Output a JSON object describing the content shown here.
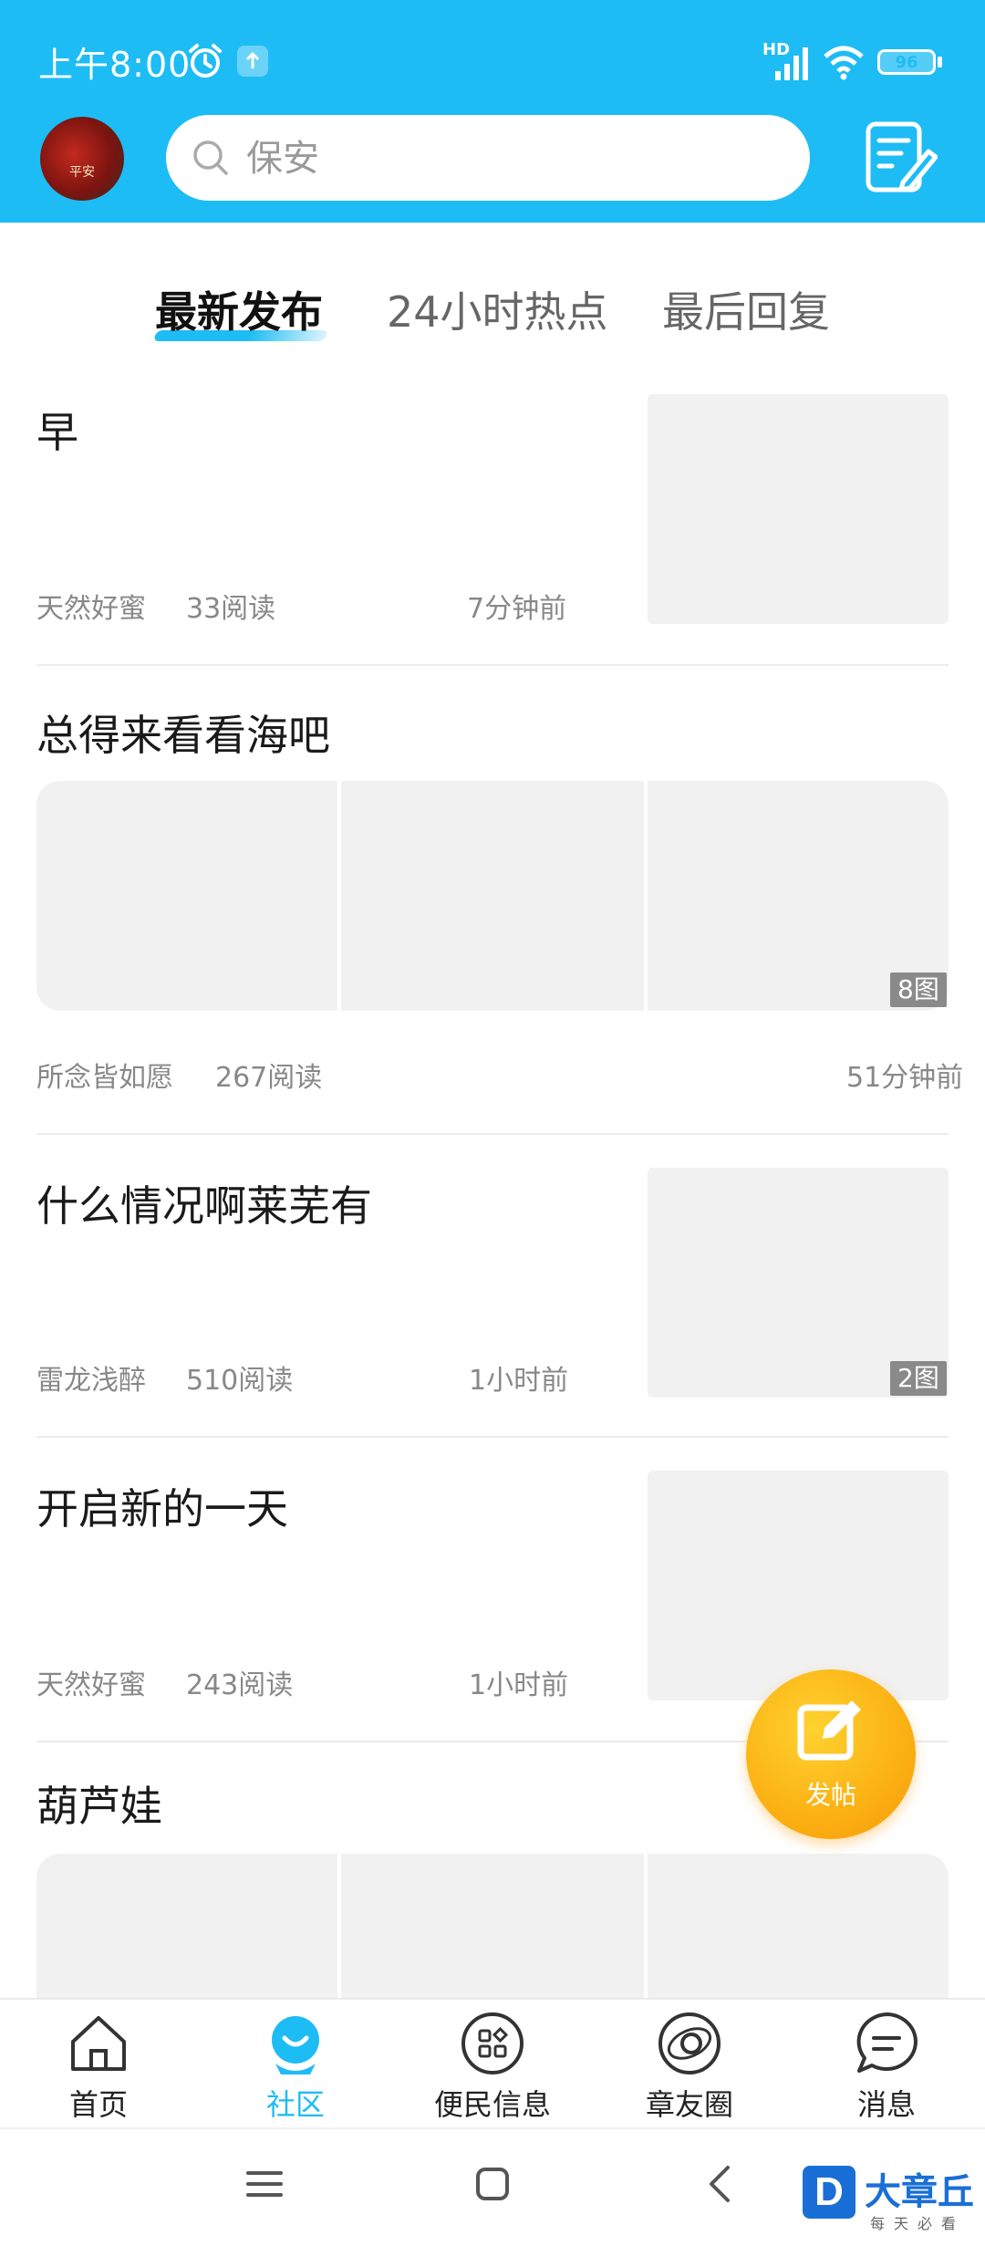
{
  "status_bar": {
    "time": "上午8:00",
    "hd": "HD",
    "battery": "96",
    "battery_level": 0.96
  },
  "header": {
    "avatar_text": "平安",
    "search_placeholder": "保安",
    "colors": {
      "brand": "#1ebcf4",
      "accent": "#fbb013"
    }
  },
  "tabs": [
    {
      "label": "最新发布",
      "active": true
    },
    {
      "label": "24小时热点",
      "active": false
    },
    {
      "label": "最后回复",
      "active": false
    }
  ],
  "posts": [
    {
      "title": "早",
      "author": "天然好蜜",
      "reads": "33阅读",
      "time": "7分钟前"
    },
    {
      "title": "总得来看看海吧",
      "author": "所念皆如愿",
      "reads": "267阅读",
      "time": "51分钟前",
      "image_count": "8图"
    },
    {
      "title": "什么情况啊莱芜有",
      "author": "雷龙浅醉",
      "reads": "510阅读",
      "time": "1小时前",
      "image_count": "2图"
    },
    {
      "title": "开启新的一天",
      "author": "天然好蜜",
      "reads": "243阅读",
      "time": "1小时前"
    },
    {
      "title": "葫芦娃"
    }
  ],
  "fab": {
    "label": "发帖",
    "icon": "edit-icon"
  },
  "bottom_nav": [
    {
      "label": "首页",
      "icon": "home-icon",
      "active": false
    },
    {
      "label": "社区",
      "icon": "community-icon",
      "active": true
    },
    {
      "label": "便民信息",
      "icon": "apps-icon",
      "active": false
    },
    {
      "label": "章友圈",
      "icon": "planet-icon",
      "active": false
    },
    {
      "label": "消息",
      "icon": "chat-icon",
      "active": false
    }
  ],
  "watermark": {
    "name": "大章丘",
    "sub": "每天必看",
    "logo": "D"
  }
}
